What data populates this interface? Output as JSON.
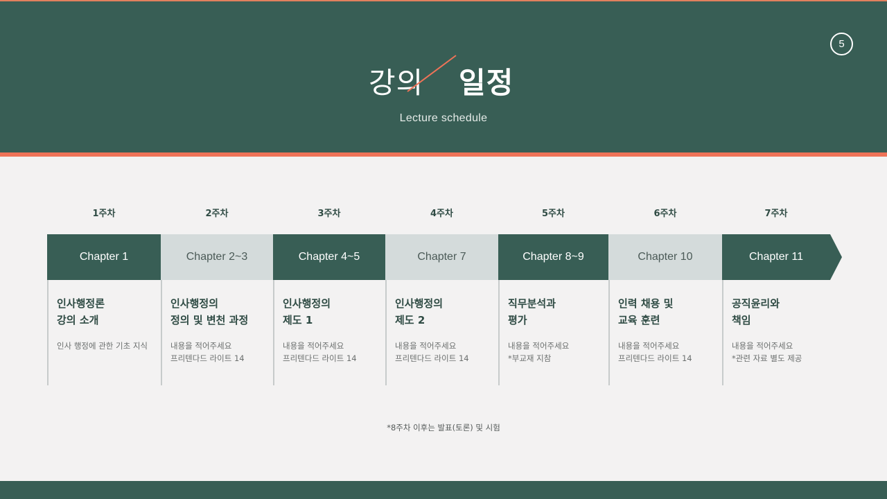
{
  "slide": {
    "page_number": "5",
    "title_light": "강의",
    "title_bold": "일정",
    "subtitle": "Lecture schedule",
    "footnote": "*8주차 이후는 발표(토론) 및 시험"
  },
  "colors": {
    "header": "#385e55",
    "accent": "#ef7358",
    "chapter_dark": "#385e55",
    "chapter_light": "#d4dbdb",
    "background": "#f3f2f2"
  },
  "schedule": [
    {
      "week": "1주차",
      "chapter": "Chapter 1",
      "style": "dark",
      "topic_line1": "인사행정론",
      "topic_line2": "강의 소개",
      "desc_line1": "인사 행정에 관한 기초 지식",
      "desc_line2": ""
    },
    {
      "week": "2주차",
      "chapter": "Chapter 2~3",
      "style": "light",
      "topic_line1": "인사행정의",
      "topic_line2": "정의 및 변천 과정",
      "desc_line1": "내용을 적어주세요",
      "desc_line2": "프리텐다드 라이트 14"
    },
    {
      "week": "3주차",
      "chapter": "Chapter 4~5",
      "style": "dark",
      "topic_line1": "인사행정의",
      "topic_line2": "제도 1",
      "desc_line1": "내용을 적어주세요",
      "desc_line2": "프리텐다드 라이트 14"
    },
    {
      "week": "4주차",
      "chapter": "Chapter 7",
      "style": "light",
      "topic_line1": "인사행정의",
      "topic_line2": "제도 2",
      "desc_line1": "내용을 적어주세요",
      "desc_line2": "프리텐다드 라이트 14"
    },
    {
      "week": "5주차",
      "chapter": "Chapter 8~9",
      "style": "dark",
      "topic_line1": "직무분석과",
      "topic_line2": "평가",
      "desc_line1": "내용을 적어주세요",
      "desc_line2": "*부교재 지참"
    },
    {
      "week": "6주차",
      "chapter": "Chapter 10",
      "style": "light",
      "topic_line1": "인력 채용 및",
      "topic_line2": "교육 훈련",
      "desc_line1": "내용을 적어주세요",
      "desc_line2": "프리텐다드 라이트 14"
    },
    {
      "week": "7주차",
      "chapter": "Chapter 11",
      "style": "dark",
      "topic_line1": "공직윤리와",
      "topic_line2": "책임",
      "desc_line1": "내용을 적어주세요",
      "desc_line2": "*관련 자료 별도 제공"
    }
  ]
}
